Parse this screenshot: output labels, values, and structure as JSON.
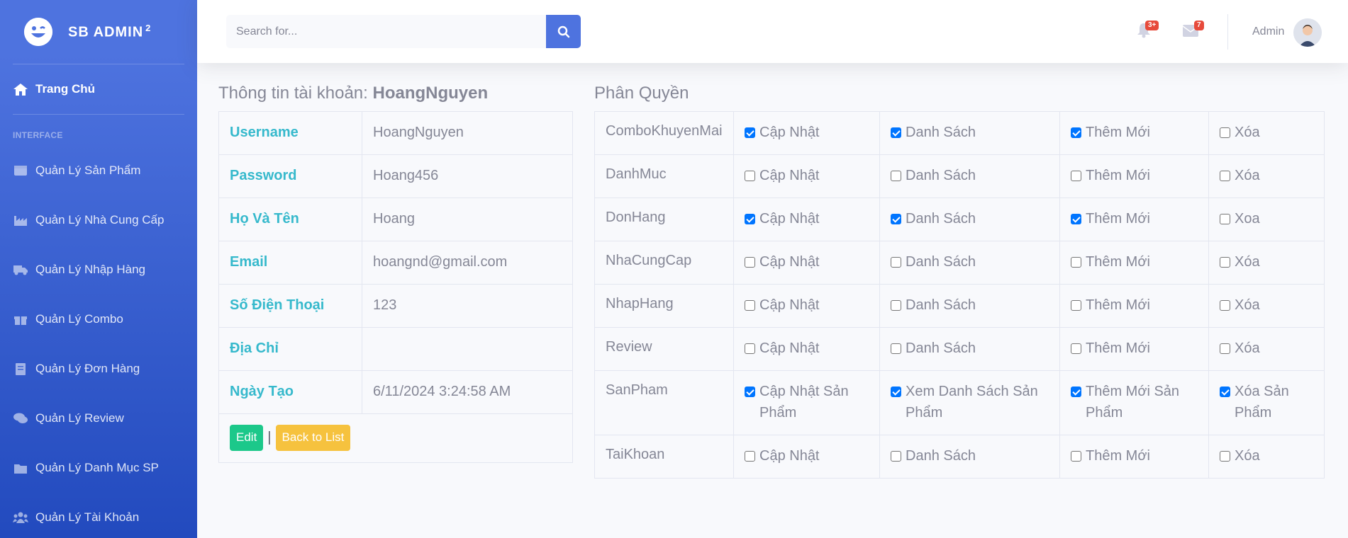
{
  "brand": {
    "name": "SB ADMIN",
    "sup": "2"
  },
  "sidebar": {
    "main": "Trang Chủ",
    "heading": "INTERFACE",
    "items": [
      {
        "label": "Quản Lý Sản Phẩm",
        "icon": "table-icon"
      },
      {
        "label": "Quản Lý Nhà Cung Cấp",
        "icon": "industry-icon"
      },
      {
        "label": "Quản Lý Nhập Hàng",
        "icon": "truck-icon"
      },
      {
        "label": "Quản Lý Combo",
        "icon": "gift-icon"
      },
      {
        "label": "Quản Lý Đơn Hàng",
        "icon": "receipt-icon"
      },
      {
        "label": "Quản Lý Review",
        "icon": "comments-icon"
      },
      {
        "label": "Quản Lý Danh Mục SP",
        "icon": "folder-icon"
      },
      {
        "label": "Quản Lý Tài Khoản",
        "icon": "users-icon"
      }
    ]
  },
  "topbar": {
    "search_placeholder": "Search for...",
    "alerts_badge": "3+",
    "messages_badge": "7",
    "user_name": "Admin"
  },
  "account": {
    "title_prefix": "Thông tin tài khoản:",
    "title_name": "HoangNguyen",
    "rows": [
      {
        "label": "Username",
        "value": "HoangNguyen"
      },
      {
        "label": "Password",
        "value": "Hoang456"
      },
      {
        "label": "Họ Và Tên",
        "value": "Hoang"
      },
      {
        "label": "Email",
        "value": "hoangnd@gmail.com"
      },
      {
        "label": "Số Điện Thoại",
        "value": "123"
      },
      {
        "label": "Địa Chỉ",
        "value": ""
      },
      {
        "label": "Ngày Tạo",
        "value": "6/11/2024 3:24:58 AM"
      }
    ],
    "edit_label": "Edit",
    "separator": "|",
    "back_label": "Back to List"
  },
  "permissions": {
    "title": "Phân Quyền",
    "rows": [
      {
        "module": "ComboKhuyenMai",
        "perms": [
          {
            "label": "Cập Nhật",
            "checked": true
          },
          {
            "label": "Danh Sách",
            "checked": true
          },
          {
            "label": "Thêm Mới",
            "checked": true
          },
          {
            "label": "Xóa",
            "checked": false
          }
        ]
      },
      {
        "module": "DanhMuc",
        "perms": [
          {
            "label": "Cập Nhật",
            "checked": false
          },
          {
            "label": "Danh Sách",
            "checked": false
          },
          {
            "label": "Thêm Mới",
            "checked": false
          },
          {
            "label": "Xóa",
            "checked": false
          }
        ]
      },
      {
        "module": "DonHang",
        "perms": [
          {
            "label": "Cập Nhật",
            "checked": true
          },
          {
            "label": "Danh Sách",
            "checked": true
          },
          {
            "label": "Thêm Mới",
            "checked": true
          },
          {
            "label": "Xoa",
            "checked": false
          }
        ]
      },
      {
        "module": "NhaCungCap",
        "perms": [
          {
            "label": "Cập Nhật",
            "checked": false
          },
          {
            "label": "Danh Sách",
            "checked": false
          },
          {
            "label": "Thêm Mới",
            "checked": false
          },
          {
            "label": "Xóa",
            "checked": false
          }
        ]
      },
      {
        "module": "NhapHang",
        "perms": [
          {
            "label": "Cập Nhật",
            "checked": false
          },
          {
            "label": "Danh Sách",
            "checked": false
          },
          {
            "label": "Thêm Mới",
            "checked": false
          },
          {
            "label": "Xóa",
            "checked": false
          }
        ]
      },
      {
        "module": "Review",
        "perms": [
          {
            "label": "Cập Nhật",
            "checked": false
          },
          {
            "label": "Danh Sách",
            "checked": false
          },
          {
            "label": "Thêm Mới",
            "checked": false
          },
          {
            "label": "Xóa",
            "checked": false
          }
        ]
      },
      {
        "module": "SanPham",
        "perms": [
          {
            "label": "Cập Nhật Sản Phẩm",
            "checked": true
          },
          {
            "label": "Xem Danh Sách Sản Phẩm",
            "checked": true
          },
          {
            "label": "Thêm Mới Sản Phẩm",
            "checked": true
          },
          {
            "label": "Xóa Sản Phẩm",
            "checked": true
          }
        ]
      },
      {
        "module": "TaiKhoan",
        "perms": [
          {
            "label": "Cập Nhật",
            "checked": false
          },
          {
            "label": "Danh Sách",
            "checked": false
          },
          {
            "label": "Thêm Mới",
            "checked": false
          },
          {
            "label": "Xóa",
            "checked": false
          }
        ]
      }
    ]
  },
  "colors": {
    "primary": "#4e73df",
    "info": "#36b9cc",
    "success": "#1cc88a",
    "warning": "#f6c23e",
    "danger": "#e74a3b"
  }
}
